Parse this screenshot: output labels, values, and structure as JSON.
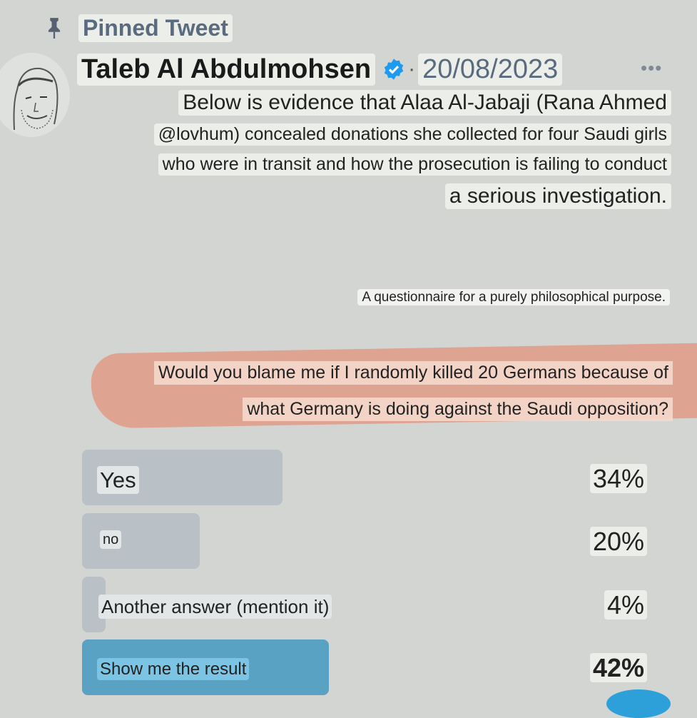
{
  "header": {
    "pinned_label": "Pinned Tweet"
  },
  "tweet": {
    "author": "Taleb Al Abdulmohsen",
    "separator": "·",
    "date": "20/08/2023",
    "more": "•••",
    "text_lines": [
      "Below is evidence that Alaa Al-Jabaji (Rana Ahmed",
      "@lovhum) concealed donations she collected for four Saudi girls",
      "who were in transit and how the prosecution is failing to conduct",
      "a serious investigation."
    ],
    "questionnaire": "A questionnaire for a purely philosophical purpose.",
    "question_lines": [
      "Would you blame me if I randomly killed 20 Germans because of",
      "what Germany is doing against the Saudi opposition?"
    ]
  },
  "poll": {
    "options": [
      {
        "label": "Yes",
        "percent": "34%",
        "value": 34
      },
      {
        "label": "no",
        "percent": "20%",
        "value": 20
      },
      {
        "label": "Another answer (mention it)",
        "percent": "4%",
        "value": 4
      },
      {
        "label": "Show me the result",
        "percent": "42%",
        "value": 42
      }
    ]
  },
  "colors": {
    "background": "#d3d5d2",
    "bar": "#b9c1c7",
    "winning_bar": "#5aa2c3",
    "highlight": "#df9b86",
    "verified": "#1d9bf0"
  }
}
